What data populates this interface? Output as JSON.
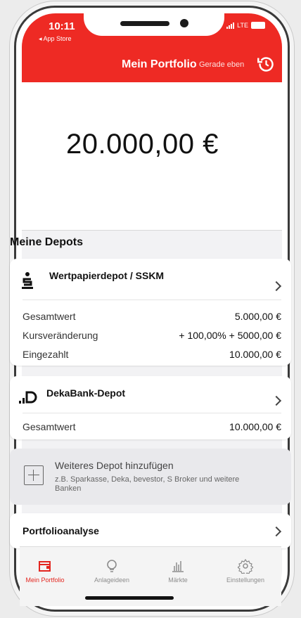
{
  "status": {
    "time": "10:11",
    "back": "◂ App Store",
    "network": "LTE"
  },
  "header": {
    "title": "Mein Portfolio",
    "updated": "Gerade eben"
  },
  "portfolio": {
    "total": "20.000,00 €"
  },
  "depots": {
    "title": "Meine Depots",
    "items": [
      {
        "name": "Wertpapierdepot / SSKM",
        "rows": [
          {
            "label": "Gesamtwert",
            "value": "5.000,00 €"
          },
          {
            "label": "Kursveränderung",
            "value": "+ 100,00%",
            "value2": "+ 5000,00 €"
          },
          {
            "label": "Eingezahlt",
            "value": "10.000,00 €"
          }
        ]
      },
      {
        "name": "DekaBank-Depot",
        "rows": [
          {
            "label": "Gesamtwert",
            "value": "10.000,00 €"
          }
        ]
      }
    ],
    "add": {
      "title": "Weiteres Depot hinzufügen",
      "subtitle": "z.B. Sparkasse, Deka, bevestor, S Broker und weitere Banken"
    }
  },
  "analysis": {
    "title": "Portfolioanalyse"
  },
  "tabs": [
    {
      "label": "Mein Portfolio",
      "icon": "wallet-icon",
      "active": true
    },
    {
      "label": "Anlageideen",
      "icon": "lightbulb-icon",
      "active": false
    },
    {
      "label": "Märkte",
      "icon": "bar-chart-icon",
      "active": false
    },
    {
      "label": "Einstellungen",
      "icon": "gear-icon",
      "active": false
    }
  ],
  "colors": {
    "brand": "#ee2a24",
    "positive": "#2a9c45"
  }
}
